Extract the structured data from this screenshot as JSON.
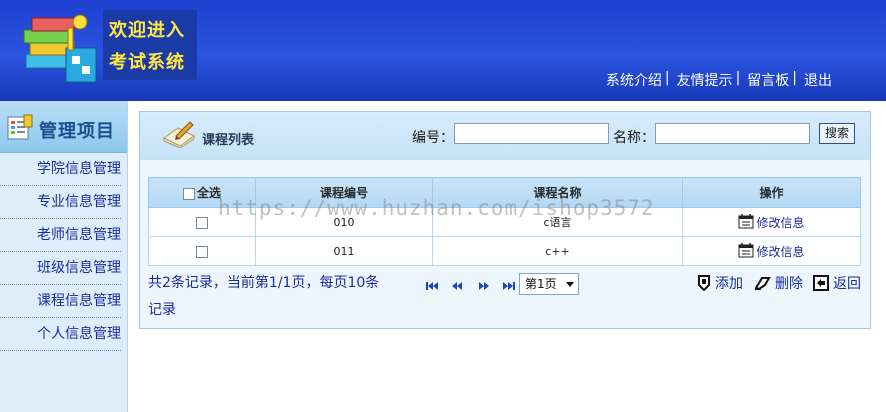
{
  "header": {
    "logo_line1": "欢迎进入",
    "logo_line2": "考试系统",
    "nav": [
      "系统介绍",
      "友情提示",
      "留言板",
      "退出"
    ],
    "nav_sep": "|"
  },
  "sidebar": {
    "title": "管理项目",
    "items": [
      "学院信息管理",
      "专业信息管理",
      "老师信息管理",
      "班级信息管理",
      "课程信息管理",
      "个人信息管理"
    ]
  },
  "panel": {
    "title": "课程列表",
    "code_label": "编号：",
    "name_label": "名称：",
    "code_value": "",
    "name_value": "",
    "search_label": "搜索"
  },
  "table": {
    "headers": [
      "全选",
      "课程编号",
      "课程名称",
      "操作"
    ],
    "rows": [
      {
        "code": "010",
        "name": "c语言",
        "action": "修改信息"
      },
      {
        "code": "011",
        "name": "c++",
        "action": "修改信息"
      }
    ]
  },
  "pager": {
    "info": "共2条记录，当前第1/1页，每页10条记录",
    "page_select": "第1页"
  },
  "actions": {
    "add": "添加",
    "delete": "删除",
    "back": "返回"
  },
  "watermark": "https://www.huzhan.com/ishop3572",
  "colors": {
    "header_blue": "#2a55e0",
    "logo_yellow": "#ffe840",
    "link_blue": "#1a2c9c",
    "panel_bg": "#eef6fd"
  }
}
